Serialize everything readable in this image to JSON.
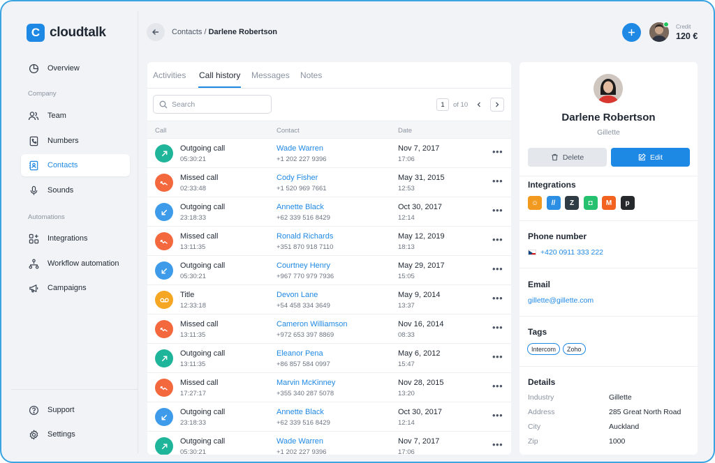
{
  "app": {
    "brand": "cloudtalk",
    "brand_letter": "C"
  },
  "sidebar": {
    "overview": "Overview",
    "section_company": "Company",
    "team": "Team",
    "numbers": "Numbers",
    "contacts": "Contacts",
    "sounds": "Sounds",
    "section_automations": "Automations",
    "integrations": "Integrations",
    "workflow": "Workflow automation",
    "campaigns": "Campaigns",
    "support": "Support",
    "settings": "Settings",
    "active_item": "Contacts"
  },
  "header": {
    "breadcrumb_parent": "Contacts",
    "breadcrumb_sep": "/",
    "breadcrumb_current": "Darlene Robertson",
    "credit_label": "Credit",
    "credit_value": "120 €"
  },
  "tabs": [
    "Activities",
    "Call history",
    "Messages",
    "Notes"
  ],
  "active_tab": "Call history",
  "search": {
    "placeholder": "Search"
  },
  "pager": {
    "current": "1",
    "of_text": "of 10"
  },
  "table": {
    "headers": {
      "call": "Call",
      "contact": "Contact",
      "date": "Date"
    },
    "rows": [
      {
        "kind": "outgoing",
        "type": "Outgoing call",
        "duration": "05:30:21",
        "name": "Wade Warren",
        "phone": "+1 202 227 9396",
        "date": "Nov 7, 2017",
        "time": "17:06"
      },
      {
        "kind": "missed",
        "type": "Missed call",
        "duration": "02:33:48",
        "name": "Cody Fisher",
        "phone": "+1 520 969 7661",
        "date": "May 31, 2015",
        "time": "12:53"
      },
      {
        "kind": "incoming",
        "type": "Outgoing call",
        "duration": "23:18:33",
        "name": "Annette Black",
        "phone": "+62 339 516 8429",
        "date": "Oct 30, 2017",
        "time": "12:14"
      },
      {
        "kind": "missed",
        "type": "Missed call",
        "duration": "13:11:35",
        "name": "Ronald Richards",
        "phone": "+351 870 918 7110",
        "date": "May 12, 2019",
        "time": "18:13"
      },
      {
        "kind": "incoming",
        "type": "Outgoing call",
        "duration": "05:30:21",
        "name": "Courtney Henry",
        "phone": "+967 770 979 7936",
        "date": "May 29, 2017",
        "time": "15:05"
      },
      {
        "kind": "voicemail",
        "type": "Title",
        "duration": "12:33:18",
        "name": "Devon Lane",
        "phone": "+54 458 334 3649",
        "date": "May 9, 2014",
        "time": "13:37"
      },
      {
        "kind": "missed",
        "type": "Missed call",
        "duration": "13:11:35",
        "name": "Cameron Williamson",
        "phone": "+972 653 397 8869",
        "date": "Nov 16, 2014",
        "time": "08:33"
      },
      {
        "kind": "outgoing",
        "type": "Outgoing call",
        "duration": "13:11:35",
        "name": "Eleanor Pena",
        "phone": "+86 857 584 0997",
        "date": "May 6, 2012",
        "time": "15:47"
      },
      {
        "kind": "missed",
        "type": "Missed call",
        "duration": "17:27:17",
        "name": "Marvin McKinney",
        "phone": "+355 340 287 5078",
        "date": "Nov 28, 2015",
        "time": "13:20"
      },
      {
        "kind": "incoming",
        "type": "Outgoing call",
        "duration": "23:18:33",
        "name": "Annette Black",
        "phone": "+62 339 516 8429",
        "date": "Oct 30, 2017",
        "time": "12:14"
      },
      {
        "kind": "outgoing",
        "type": "Outgoing call",
        "duration": "05:30:21",
        "name": "Wade Warren",
        "phone": "+1 202 227 9396",
        "date": "Nov 7, 2017",
        "time": "17:06"
      }
    ]
  },
  "colors": {
    "outgoing": "#1fb59a",
    "missed": "#f4683e",
    "incoming": "#3d9be9",
    "voicemail": "#f5a623",
    "accent": "#1e88e5"
  },
  "profile": {
    "name": "Darlene Robertson",
    "company": "Gillette",
    "delete_label": "Delete",
    "edit_label": "Edit",
    "integrations_title": "Integrations",
    "integrations": [
      {
        "name": "chat-bubble",
        "color": "#f29a1f",
        "glyph": "☺"
      },
      {
        "name": "stripes",
        "color": "#2d8fe3",
        "glyph": "//"
      },
      {
        "name": "zendesk",
        "color": "#2f3b45",
        "glyph": "Z"
      },
      {
        "name": "freshdesk",
        "color": "#25c16f",
        "glyph": "◘"
      },
      {
        "name": "magento",
        "color": "#f26322",
        "glyph": "M"
      },
      {
        "name": "pipedrive",
        "color": "#26292c",
        "glyph": "p"
      }
    ],
    "phone_title": "Phone number",
    "phone": "+420 0911 333 222",
    "email_title": "Email",
    "email": "gillette@gillette.com",
    "tags_title": "Tags",
    "tags": [
      "Intercom",
      "Zoho"
    ],
    "details_title": "Details",
    "details": [
      {
        "key": "Industry",
        "value": "Gillette"
      },
      {
        "key": "Address",
        "value": "285 Great North Road"
      },
      {
        "key": "City",
        "value": "Auckland"
      },
      {
        "key": "Zip",
        "value": "1000"
      }
    ]
  }
}
